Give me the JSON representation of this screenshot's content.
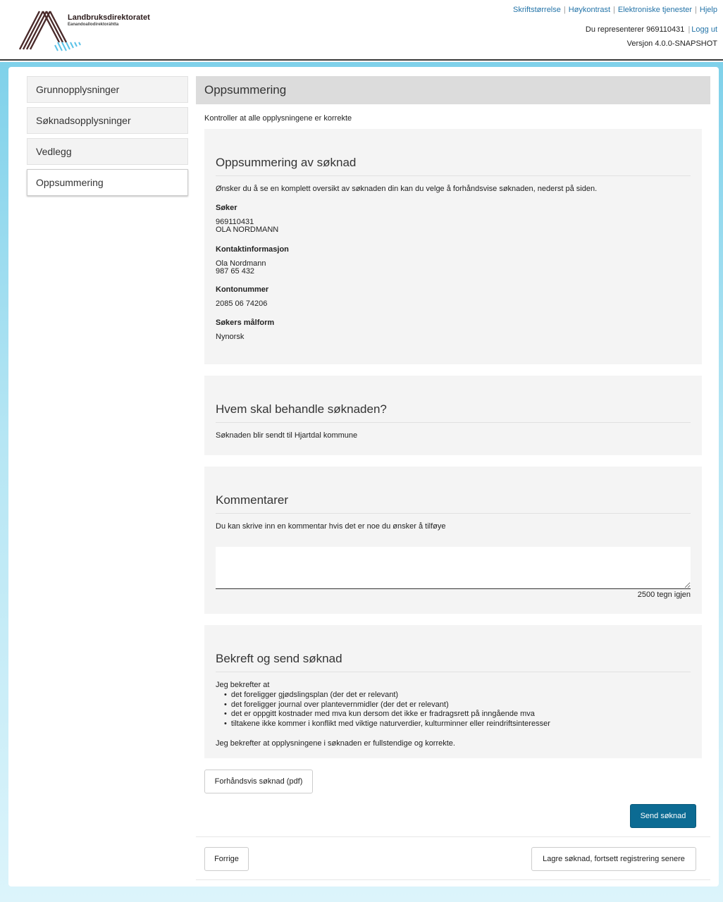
{
  "header": {
    "logo_title": "Landbruksdirektoratet",
    "logo_subtitle": "Eanandoallodirektoráhtta",
    "links": [
      "Skriftstørrelse",
      "Høykontrast",
      "Elektroniske tjenester",
      "Hjelp"
    ],
    "representing_text": "Du representerer 969110431",
    "logout_label": "Logg ut",
    "version": "Versjon 4.0.0-SNAPSHOT"
  },
  "sidebar": {
    "items": [
      {
        "label": "Grunnopplysninger"
      },
      {
        "label": "Søknadsopplysninger"
      },
      {
        "label": "Vedlegg"
      },
      {
        "label": "Oppsummering"
      }
    ]
  },
  "main": {
    "title": "Oppsummering",
    "intro": "Kontroller at alle opplysningene er korrekte"
  },
  "summary": {
    "title": "Oppsummering av søknad",
    "description": "Ønsker du å se en komplett oversikt av søknaden din kan du velge å forhåndsvise søknaden, nederst på siden.",
    "applicant_label": "Søker",
    "applicant_id": "969110431",
    "applicant_name": "OLA NORDMANN",
    "contact_label": "Kontaktinformasjon",
    "contact_name": "Ola Nordmann",
    "contact_phone": "987 65 432",
    "account_label": "Kontonummer",
    "account_number": "2085 06 74206",
    "language_label": "Søkers målform",
    "language_value": "Nynorsk"
  },
  "handler": {
    "title": "Hvem skal behandle søknaden?",
    "text": "Søknaden blir sendt til Hjartdal kommune"
  },
  "comments": {
    "title": "Kommentarer",
    "description": "Du kan skrive inn en kommentar hvis det er noe du ønsker å tilføye",
    "value": "",
    "counter": "2500 tegn igjen"
  },
  "confirm": {
    "title": "Bekreft og send søknad",
    "intro": "Jeg bekrefter at",
    "items": [
      "det foreligger gjødslingsplan (der det er relevant)",
      "det foreligger journal over plantevernmidler (der det er relevant)",
      "det er oppgitt kostnader med mva kun dersom det ikke er fradragsrett på inngående mva",
      "tiltakene ikke kommer i konflikt med viktige naturverdier, kulturminner eller reindriftsinteresser"
    ],
    "final": "Jeg bekrefter at opplysningene i søknaden er fullstendige og korrekte."
  },
  "buttons": {
    "preview": "Forhåndsvis søknad (pdf)",
    "send": "Send søknad",
    "previous": "Forrige",
    "save_later": "Lagre søknad, fortsett registrering senere"
  },
  "colors": {
    "link": "#2474a8",
    "primary": "#0c6b93",
    "logo_brown": "#4a2a2a",
    "logo_blue": "#5bc2e7"
  }
}
